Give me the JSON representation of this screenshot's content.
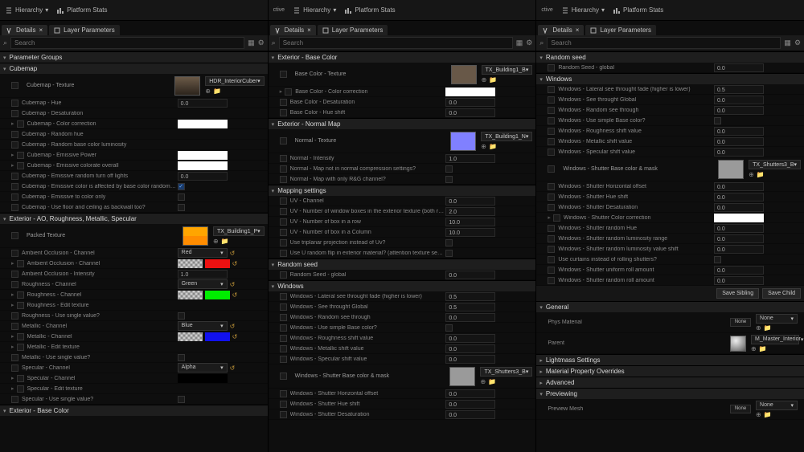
{
  "toolbar": {
    "hierarchy": "Hierarchy",
    "platformStats": "Platform Stats",
    "ctive": "ctive"
  },
  "tabs": {
    "details": "Details",
    "layerParams": "Layer Parameters"
  },
  "search": {
    "ph": "Search"
  },
  "left": {
    "paramGroups": "Parameter Groups",
    "cubemap": "Cubemap",
    "cubemapRows": [
      "Cubemap - Texture",
      "Cubemap - Hue",
      "Cubemap - Desaturation",
      "Cubemap - Color correction",
      "Cubemap - Random hue",
      "Cubemap - Random base color luminosity",
      "Cubemap - Emissive Power",
      "Cubemap - Emissive colorate overall",
      "Cubemap - Emissive random turn off lights",
      "Cubemap - Emissive color is affected by base color randomness?",
      "Cubemap - Emissive to color only",
      "Cubemap - Use floor and ceiling as backwall too?"
    ],
    "hdrTex": "HDR_InteriorCuber",
    "cubemapVals": {
      "hue": "0.0",
      "aniso": "0.0"
    },
    "extAO": "Exterior - AO, Roughness, Metallic, Specular",
    "packed": "Packed Texture",
    "texBldg": "TX_Building1_P",
    "aoRows": [
      "Ambient Occlusion - Channel",
      "Ambient Occlusion - Channel",
      "Ambient Occlusion - Intensity",
      "Roughness - Channel",
      "Roughness - Channel",
      "Roughness - Edit texture",
      "Roughness - Use single value?",
      "Metallic - Channel",
      "Metallic - Channel",
      "Metallic - Edit texture",
      "Metallic - Use single value?",
      "Specular - Channel",
      "Specular - Channel",
      "Specular - Edit texture",
      "Specular - Use single value?"
    ],
    "chan": {
      "red": "Red",
      "green": "Green",
      "blue": "Blue",
      "alpha": "Alpha"
    },
    "intensity": "1.0",
    "extBase": "Exterior - Base Color"
  },
  "mid": {
    "extBase": "Exterior - Base Color",
    "baseRows": [
      "Base Color - Texture",
      "Base Color - Color correction",
      "Base Color - Desaturation",
      "Base Color - Hue shift"
    ],
    "texBldgB": "TX_Building1_B",
    "vals": {
      "desat": "0.0",
      "hue": "0.0"
    },
    "extNorm": "Exterior - Normal Map",
    "normRows": [
      "Normal - Texture",
      "Normal - Intensity",
      "Normal - Map not in normal compression settings?",
      "Normal - Map with only R&G channel?"
    ],
    "texBldgN": "TX_Building1_N",
    "normInt": "1.0",
    "mapSet": "Mapping settings",
    "mapRows": [
      "UV - Channel",
      "UV - Number of window boxes in the exterior texture (both row and column)",
      "UV - Number of box in a row",
      "UV - Number of box in a Column",
      "Use triplanar projection instead of Uv?",
      "Use U random flip in exterior material? (attention texture seam)"
    ],
    "mapVals": {
      "ch": "0.0",
      "boxes": "2.0",
      "row": "10.0",
      "col": "10.0"
    },
    "randSeed": "Random seed",
    "randRow": "Random Seed - global",
    "randVal": "0.0",
    "windows": "Windows",
    "winRows": [
      "Windows - Lateral see throught fade (higher is lower)",
      "Windows - See throught Global",
      "Windows - Random see through",
      "Windows - Use simple Base color?",
      "Windows - Roughness shift value",
      "Windows - Metallic shift value",
      "Windows - Specular shift value",
      "Windows - Shutter Base color & mask",
      "Windows - Shutter Horizontal offset",
      "Windows - Shutter Hue shift",
      "Windows - Shutter Desaturation"
    ],
    "winVals": {
      "fade": "0.5",
      "see": "0.5",
      "rand": "0.0",
      "rough": "0.0",
      "metal": "0.0",
      "spec": "0.0",
      "h": "0.0",
      "hue": "0.0",
      "des": "0.0"
    },
    "texShut": "TX_Shutters3_B"
  },
  "right": {
    "randSeed": "Random seed",
    "randRow": "Random Seed - global",
    "randVal": "0.0",
    "windows": "Windows",
    "winRows": [
      "Windows - Lateral see throught fade (higher is lower)",
      "Windows - See throught Global",
      "Windows - Random see through",
      "Windows - Use simple Base color?",
      "Windows - Roughness shift value",
      "Windows - Metallic shift value",
      "Windows - Specular shift value",
      "Windows - Shutter Base color & mask",
      "Windows - Shutter Horizontal offset",
      "Windows - Shutter Hue shift",
      "Windows - Shutter Desaturation",
      "Windows - Shutter Color correction",
      "Windows - Shutter random Hue",
      "Windows - Shutter random luminosity range",
      "Windows - Shutter random luminosity value shift",
      "Use curtains instead of rolling shutters?",
      "Windows - Shutter uniform roll amount",
      "Windows - Shutter random roll amount"
    ],
    "winVals": {
      "fade": "0.5",
      "see": "0.0",
      "rand": "0.0",
      "rough": "0.0",
      "metal": "0.0",
      "spec": "0.0",
      "hoff": "0.0",
      "hue": "0.0",
      "des": "0.0",
      "rhue": "0.0",
      "lumr": "0.0",
      "lumv": "0.0",
      "uroll": "0.0",
      "rroll": "0.0"
    },
    "texShut": "TX_Shutters3_B",
    "btns": {
      "sibling": "Save Sibling",
      "child": "Save Child"
    },
    "general": "General",
    "physMat": "Phys Material",
    "none": "None",
    "parent": "Parent",
    "mmaster": "M_Master_Interior",
    "lightmass": "Lightmass Settings",
    "matOver": "Material Property Overrides",
    "advanced": "Advanced",
    "previewing": "Previewing",
    "previewMesh": "Preview Mesh"
  }
}
